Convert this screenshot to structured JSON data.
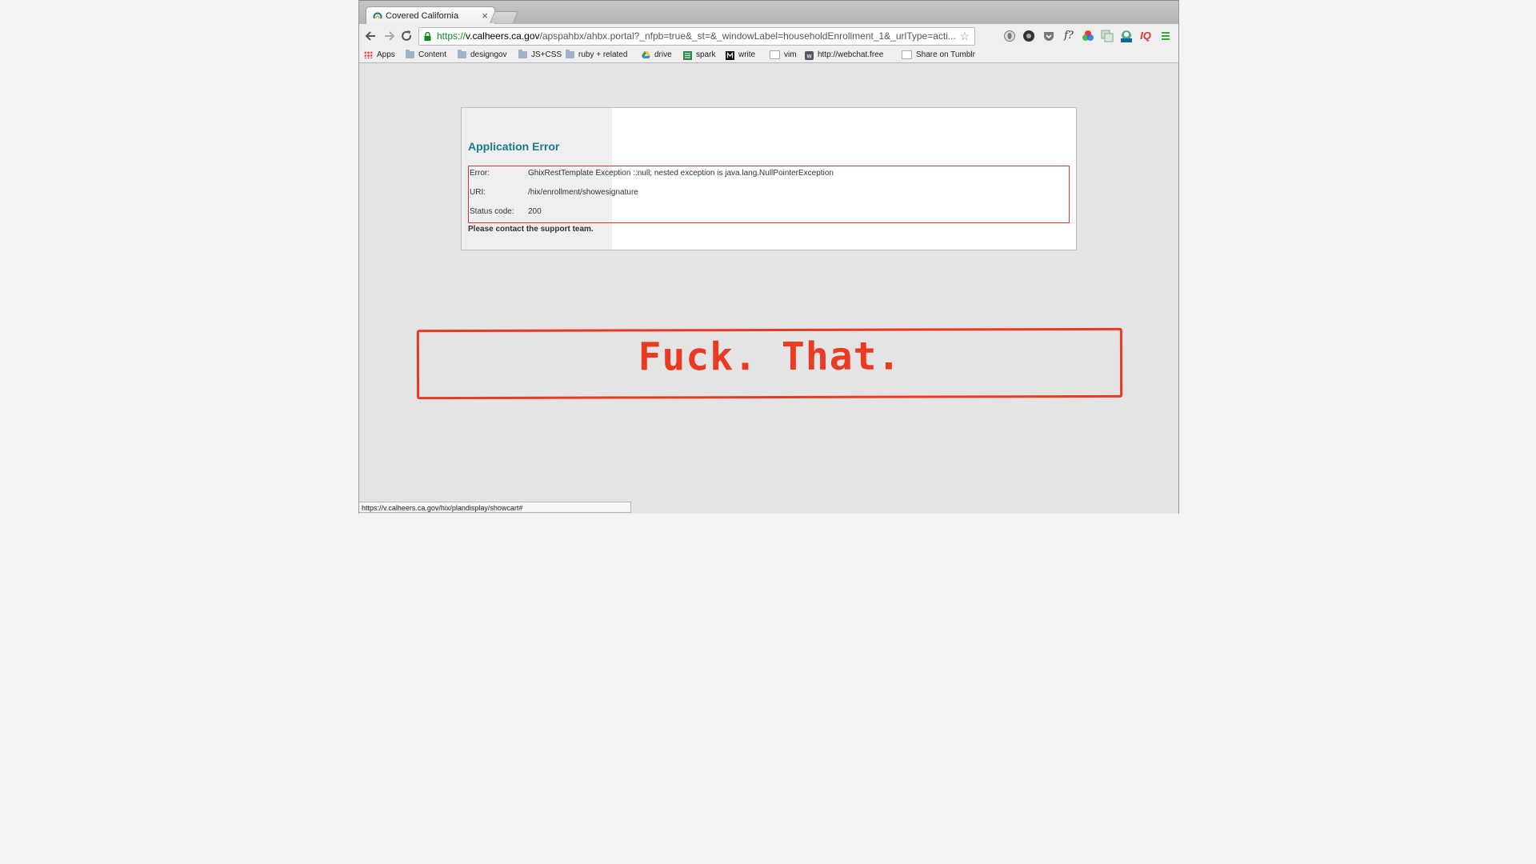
{
  "browser": {
    "tab_title": "Covered California",
    "tab_close": "×",
    "url_scheme": "https://",
    "url_host": "v.calheers.ca.gov",
    "url_path": "/apspahbx/ahbx.portal?_nfpb=true&_st=&_windowLabel=householdEnrollment_1&_urlType=acti...",
    "extensions": [
      "ghost-icon",
      "circle-icon",
      "pocket-icon",
      "font-icon",
      "color-wheel-icon",
      "layers-icon",
      "new-badge-icon",
      "iq-icon",
      "menu-icon"
    ],
    "ext_font_label": "f?",
    "ext_iq_label": "IQ"
  },
  "bookmarks": [
    {
      "label": "Apps",
      "icon": "apps-grid-icon"
    },
    {
      "label": "Content",
      "icon": "folder-icon"
    },
    {
      "label": "designgov",
      "icon": "folder-icon"
    },
    {
      "label": "JS+CSS",
      "icon": "folder-icon"
    },
    {
      "label": "ruby + related",
      "icon": "folder-icon"
    },
    {
      "label": "drive",
      "icon": "drive-icon"
    },
    {
      "label": "spark",
      "icon": "spark-icon"
    },
    {
      "label": "write",
      "icon": "write-icon"
    },
    {
      "label": "vim",
      "icon": "page-icon"
    },
    {
      "label": "http://webchat.free",
      "icon": "webchat-icon"
    },
    {
      "label": "Share on Tumblr",
      "icon": "page-icon"
    }
  ],
  "error": {
    "title": "Application Error",
    "rows": [
      {
        "key": "Error:",
        "value": "GhixRestTemplate Exception ::null; nested exception is java.lang.NullPointerException"
      },
      {
        "key": "URI:",
        "value": "/hix/enrollment/showesignature"
      },
      {
        "key": "Status code:",
        "value": "200"
      }
    ],
    "support": "Please contact the support team."
  },
  "annotation": "Fuck. That.",
  "status_url": "https://v.calheers.ca.gov/hix/plandisplay/showcart#",
  "colors": {
    "accent": "#1a7a8a",
    "annotation": "#ea3a21",
    "error_border": "#d23a3a",
    "url_secure": "#0a8a1f"
  }
}
